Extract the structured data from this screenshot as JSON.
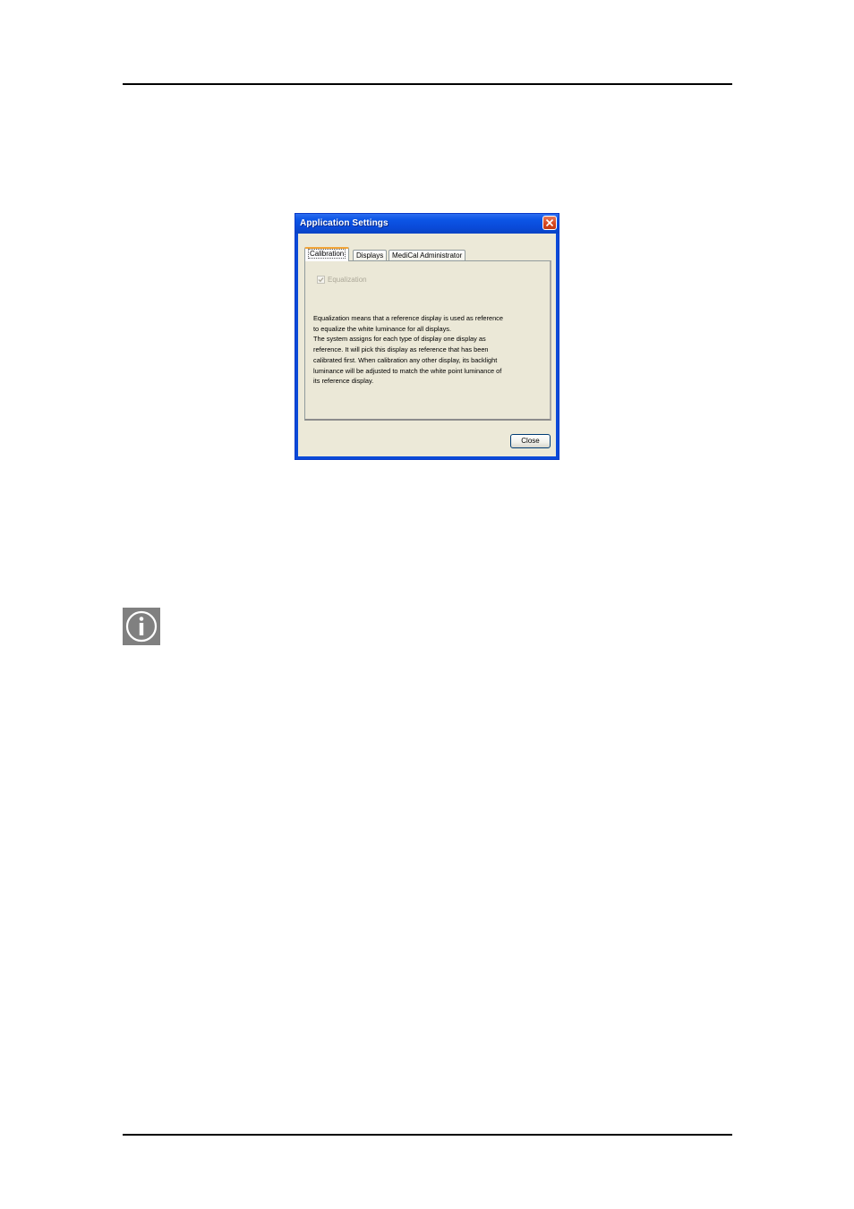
{
  "dialog": {
    "title": "Application Settings",
    "tabs": [
      {
        "label": "Calibration",
        "active": true
      },
      {
        "label": "Displays",
        "active": false
      },
      {
        "label": "MediCal Administrator",
        "active": false
      }
    ],
    "equalization": {
      "label": "Equalization",
      "checked": true,
      "enabled": false
    },
    "description_lines": [
      "Equalization means that a reference display is used as reference",
      "to equalize the white luminance for all displays.",
      "The system assigns for each type of display one display as",
      "reference. It will pick this display as reference that has been",
      "calibrated first. When calibration any other display, its backlight",
      "luminance will be adjusted to match the white point luminance of",
      "its reference display."
    ],
    "close_button_label": "Close"
  },
  "colors": {
    "titlebar": "#0a4ad8",
    "dialog_bg": "#ece9d8",
    "active_tab_accent": "#f2a63a",
    "close_x": "#d4441c",
    "info_icon_bg": "#808080"
  },
  "icons": {
    "close": "close-x-icon",
    "checkbox": "checkmark-icon",
    "info": "info-icon"
  }
}
